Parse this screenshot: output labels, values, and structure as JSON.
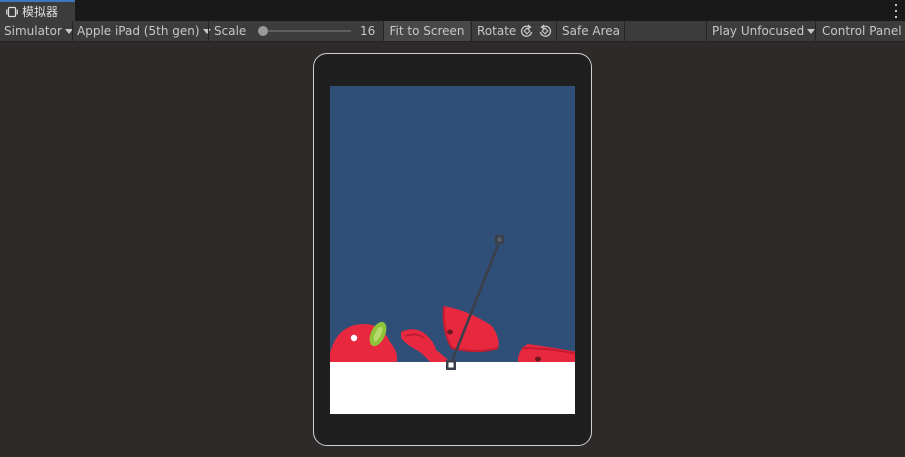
{
  "window": {
    "tab_title": "模拟器",
    "tab_icon": "simulator-icon",
    "menu_icon": "kebab-menu-icon"
  },
  "toolbar": {
    "mode_label": "Simulator",
    "device_label": "Apple iPad (5th gen)",
    "scale_label": "Scale",
    "scale_value": "16",
    "fit_label": "Fit to Screen",
    "rotate_label": "Rotate",
    "rotate_left_icon": "rotate-left-icon",
    "rotate_right_icon": "rotate-right-icon",
    "safe_area_label": "Safe Area",
    "play_label": "Play Unfocused",
    "control_panel_label": "Control Panel"
  },
  "game_view": {
    "background_color": "#2f4f78",
    "ground_color": "#ffffff",
    "fruit_color": "#e8283f",
    "leaf_color": "#8fc33a"
  }
}
